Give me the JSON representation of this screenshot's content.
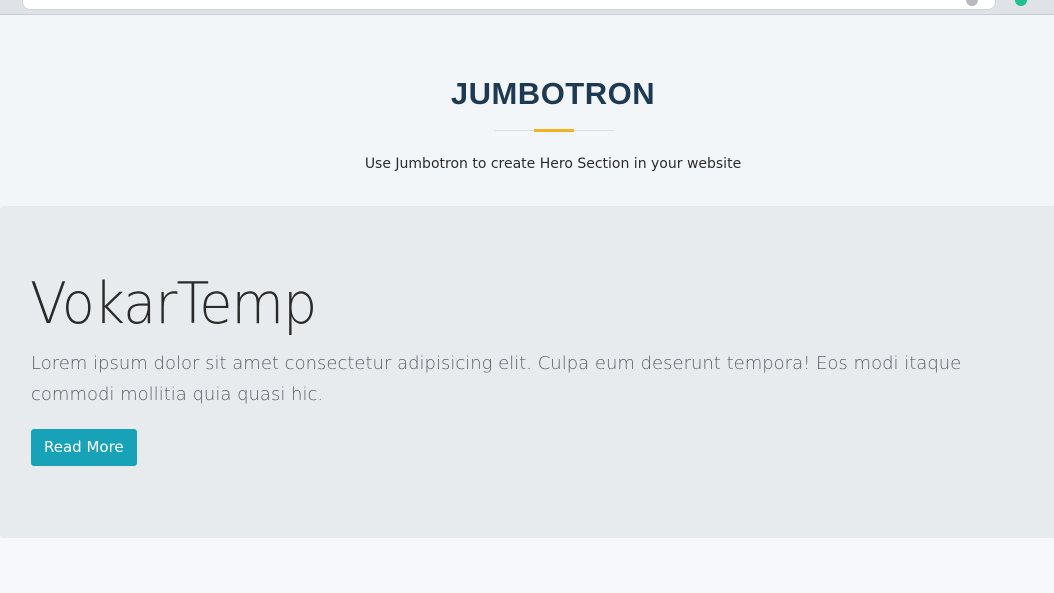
{
  "section": {
    "title": "JUMBOTRON",
    "subtitle": "Use Jumbotron to create Hero Section in your website",
    "accent_color": "#f5b41f",
    "title_color": "#1e3a52"
  },
  "jumbotron": {
    "title": "VokarTemp",
    "text": "Lorem ipsum dolor sit amet consectetur adipisicing elit. Culpa eum deserunt tempora! Eos modi itaque commodi mollitia quia quasi hic.",
    "button_label": "Read More",
    "button_color": "#17a2b8",
    "background_color": "#e8ebee"
  }
}
